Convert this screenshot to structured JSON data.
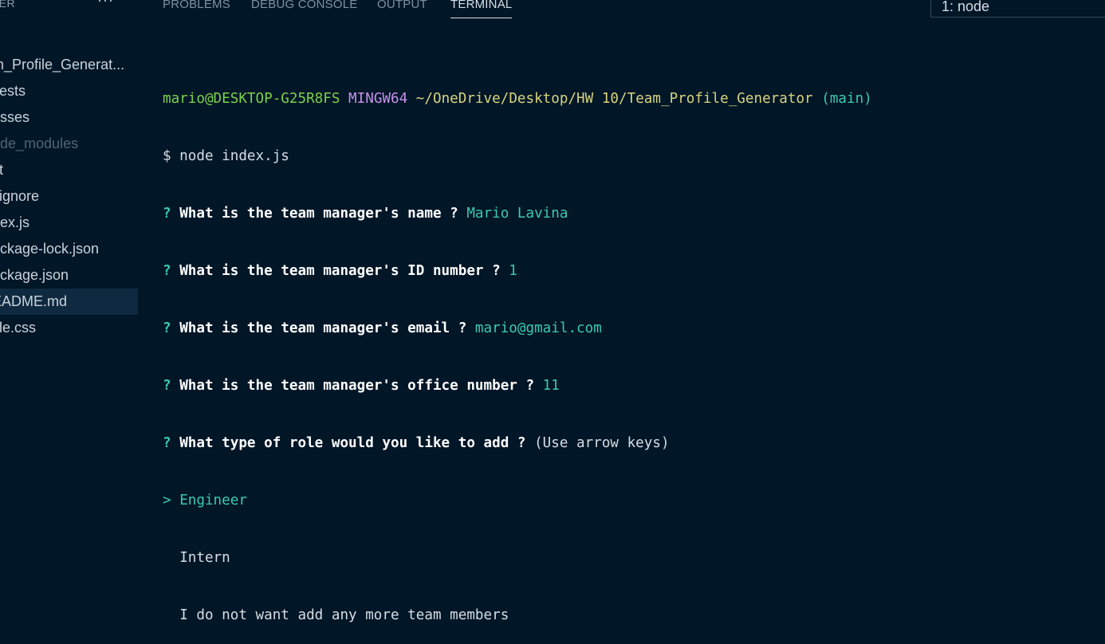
{
  "sidebar": {
    "title": "RER",
    "more": "···",
    "items": [
      {
        "label": ")"
      },
      {
        "label": "m_Profile_Generat..."
      },
      {
        "label": "sests"
      },
      {
        "label": "asses"
      },
      {
        "label": "ode_modules"
      },
      {
        "label": "st"
      },
      {
        "label": "itignore"
      },
      {
        "label": "dex.js"
      },
      {
        "label": "ackage-lock.json"
      },
      {
        "label": "ackage.json"
      },
      {
        "label": "EADME.md"
      },
      {
        "label": "yle.css"
      }
    ]
  },
  "panel": {
    "tabs": [
      {
        "label": "PROBLEMS"
      },
      {
        "label": "DEBUG CONSOLE"
      },
      {
        "label": "OUTPUT"
      },
      {
        "label": "TERMINAL"
      }
    ],
    "terminal_select": "1: node"
  },
  "terminal": {
    "prompt": {
      "user": "mario@DESKTOP-G25R8FS",
      "env": "MINGW64",
      "path": "~/OneDrive/Desktop/HW 10/Team_Profile_Generator",
      "branch": "(main)"
    },
    "command": "$ node index.js",
    "questions": [
      {
        "q": "What is the team manager's name ?",
        "a": "Mario Lavina"
      },
      {
        "q": "What is the team manager's ID number ?",
        "a": "1"
      },
      {
        "q": "What is the team manager's email ?",
        "a": "mario@gmail.com"
      },
      {
        "q": "What is the team manager's office number ?",
        "a": "11"
      }
    ],
    "role_question": "What type of role would you like to add ?",
    "role_hint": "(Use arrow keys)",
    "qmark": "?",
    "pointer": ">",
    "options": [
      {
        "label": "Engineer"
      },
      {
        "label": "Intern"
      },
      {
        "label": "I do not want add any more team members"
      }
    ]
  }
}
